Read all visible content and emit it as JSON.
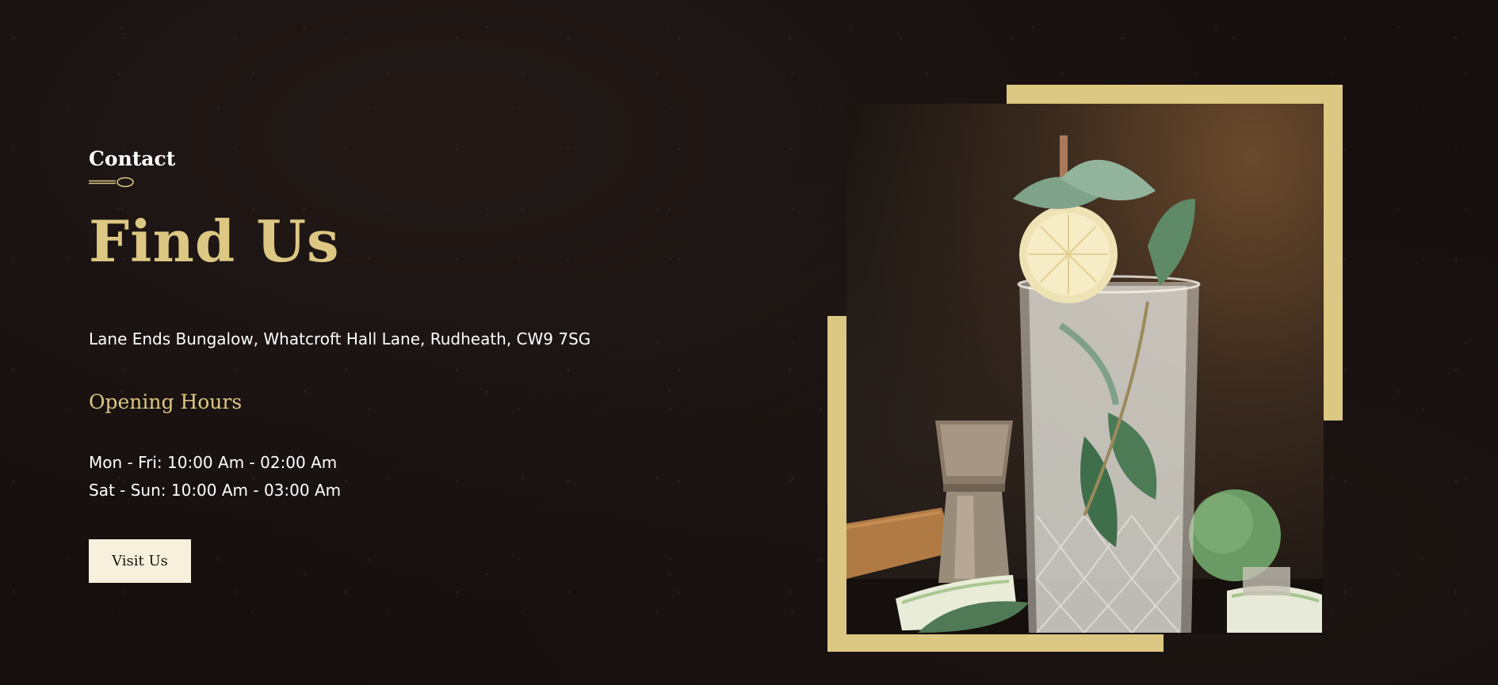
{
  "contact": {
    "eyebrow": "Contact",
    "title": "Find Us",
    "address": "Lane Ends Bungalow, Whatcroft Hall Lane, Rudheath, CW9 7SG",
    "opening_hours_title": "Opening Hours",
    "hours": [
      "Mon - Fri: 10:00 Am - 02:00 Am",
      "Sat - Sun: 10:00 Am - 03:00 Am"
    ],
    "button_label": "Visit Us"
  },
  "colors": {
    "background": "#150f0e",
    "accent": "#dcc783",
    "button_bg": "#f7f0dc",
    "text": "#ffffff"
  },
  "icons": {
    "divider": "spoon-icon"
  }
}
